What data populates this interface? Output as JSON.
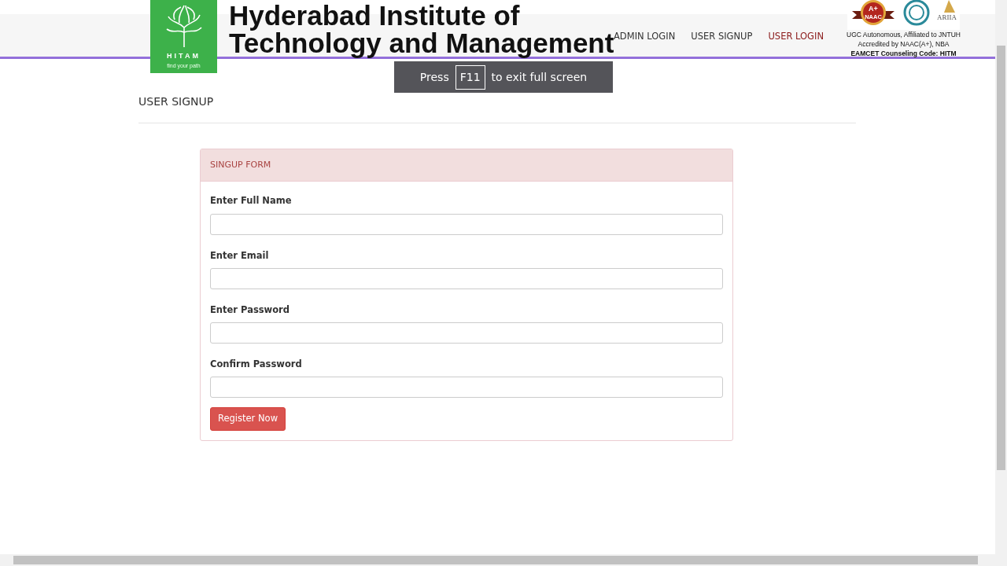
{
  "brand": {
    "logo_text": "HITAM",
    "logo_tagline": "find your path",
    "title_line_1": "Hyderabad Institute of",
    "title_line_2": "Technology and Management"
  },
  "nav": [
    {
      "label": "ADMIN LOGIN",
      "hovered": false
    },
    {
      "label": "USER SIGNUP",
      "hovered": false
    },
    {
      "label": "USER LOGIN",
      "hovered": true
    }
  ],
  "accreditation": {
    "badges": [
      "A+",
      "NAAC",
      "ARIIA"
    ],
    "lines": [
      "UGC Autonomous, Affiliated to JNTUH",
      "Accredited by NAAC(A+), NBA",
      "EAMCET Counseling Code: HITM"
    ]
  },
  "fullscreen_notice": {
    "before": "Press",
    "key": "F11",
    "after": "to exit full screen"
  },
  "page_title": "USER SIGNUP",
  "form": {
    "title": "SINGUP FORM",
    "fields": [
      {
        "label": "Enter Full Name"
      },
      {
        "label": "Enter Email"
      },
      {
        "label": "Enter Password"
      },
      {
        "label": "Confirm Password"
      }
    ],
    "submit": "Register Now"
  }
}
